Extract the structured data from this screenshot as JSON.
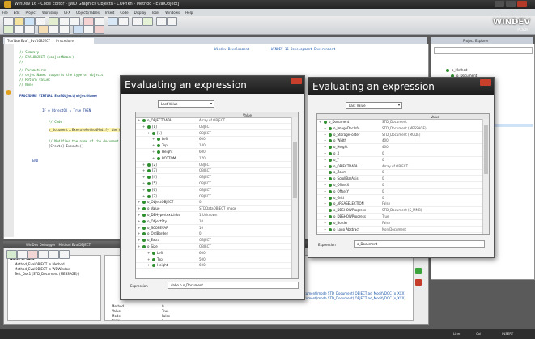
{
  "window": {
    "title": "WinDev 16 - Code Editor - [WD Graphics Objects - COPYkn - Method - EvalObject]",
    "brand": "WINDEV",
    "brand_sub": "PCSOFT"
  },
  "menu": [
    "File",
    "Edit",
    "Project",
    "Workshop",
    "GFX",
    "Objects/Tables",
    "Insert",
    "Code",
    "Display",
    "Tools",
    "Windows",
    "Help"
  ],
  "editor": {
    "tab_label": "ToolbarEval_EvalOBJECT - Procedure",
    "header_link1": "Windev Development",
    "header_link2": "WINDEV 16 Development Environment",
    "lines": [
      "// Summary",
      "//  EVALOBJECT (<objectName>)",
      "//",
      "// Parameters:",
      "//   objectName: supports the type of objects",
      "// Return value:",
      "//   None",
      "PROCEDURE VIRTUAL EvalObject(objectName)",
      "  IF o_ObjectOK = True THEN",
      "    // Code",
      "    o_Document..ExecuteMethodModify the name",
      "    // Modifies the name of the document",
      "    [Create] Execute()",
      "  END"
    ]
  },
  "right_panel": {
    "title": "Project Explorer",
    "root": "o_Method",
    "child": "o_Document"
  },
  "bottom_panel": {
    "title": "WinDev Debugger - Method EvalOBJECT",
    "col1": "Name of calls",
    "call1": "Method_EvalOBJECT in Method",
    "call2": "Method_EvalOBJECT in WDWindow",
    "call3": "Test_Doc1 (STD_Document (MESSAGE))",
    "long_path1": "Document(mode STD_Document) OBJECT ad_ModifyDOC (o_XXX)",
    "long_path2": "Document(mode STD_Document) OBJECT ad_ModifyDOC (o_XXX)",
    "rows": [
      {
        "n": "Method",
        "v": "0"
      },
      {
        "n": "Value",
        "v": "True"
      },
      {
        "n": "Mode",
        "v": "False"
      },
      {
        "n": "Binary",
        "v": "0"
      }
    ]
  },
  "status": {
    "left": "",
    "right1": "Line",
    "right2": "Col",
    "right3": "INSERT"
  },
  "dialog_left": {
    "title": "Evaluating an expression",
    "combo": "Last Value",
    "col_name": "",
    "col_value": "Value",
    "rows": [
      {
        "name": "o_OBJECTDATA",
        "value": "Array of OBJECT"
      },
      {
        "name": "[1]",
        "value": "OBJECT"
      },
      {
        "name": "[1]",
        "value": "OBJECT"
      },
      {
        "name": "Left",
        "value": "600"
      },
      {
        "name": "Top",
        "value": "140"
      },
      {
        "name": "Height",
        "value": "600"
      },
      {
        "name": "BOTTOM",
        "value": "170"
      },
      {
        "name": "[2]",
        "value": "OBJECT"
      },
      {
        "name": "[3]",
        "value": "OBJECT"
      },
      {
        "name": "[4]",
        "value": "OBJECT"
      },
      {
        "name": "[5]",
        "value": "OBJECT"
      },
      {
        "name": "[6]",
        "value": "OBJECT"
      },
      {
        "name": "[7]",
        "value": "OBJECT"
      },
      {
        "name": "o_ObjectOBJECT",
        "value": "0"
      },
      {
        "name": "o_Value",
        "value": "STDDataOBJECT Image"
      },
      {
        "name": "o_DBHypertextLinks",
        "value": "1 Unknown"
      },
      {
        "name": "o_ObjectSty",
        "value": "10"
      },
      {
        "name": "o_SCOPEVAR",
        "value": "10"
      },
      {
        "name": "o_OrdBorder",
        "value": "0"
      },
      {
        "name": "o_Extra",
        "value": "OBJECT"
      },
      {
        "name": "o_Size",
        "value": "OBJECT"
      },
      {
        "name": "Left",
        "value": "600"
      },
      {
        "name": "Top",
        "value": "500"
      },
      {
        "name": "Height",
        "value": "600"
      }
    ],
    "expr_label": "Expression",
    "expr_value": "daho.o.o_Document"
  },
  "dialog_right": {
    "title": "Evaluating an expression",
    "combo": "Last Value",
    "col_name": "",
    "col_value": "Value",
    "rows": [
      {
        "name": "o_Document",
        "value": "STD_Document"
      },
      {
        "name": "o_ImageDocInfo",
        "value": "STD_Document (MESSAGE)"
      },
      {
        "name": "o_StorageFolder",
        "value": "STD_Document (MODE)"
      },
      {
        "name": "o_Width",
        "value": "400"
      },
      {
        "name": "o_Height",
        "value": "400"
      },
      {
        "name": "o_X",
        "value": "0"
      },
      {
        "name": "o_Y",
        "value": "0"
      },
      {
        "name": "o_OBJECTDATA",
        "value": "Array of OBJECT"
      },
      {
        "name": "o_Zoom",
        "value": "0"
      },
      {
        "name": "o_ScrollBarAxis",
        "value": "0"
      },
      {
        "name": "o_OffsetX",
        "value": "0"
      },
      {
        "name": "o_OffsetY",
        "value": "0"
      },
      {
        "name": "o_Grid",
        "value": "0"
      },
      {
        "name": "o_AREASELECTION",
        "value": "False"
      },
      {
        "name": "o_DBSHOWProgress",
        "value": "STD_Document (S_MMB)"
      },
      {
        "name": "o_DBSHOWProgress",
        "value": "True"
      },
      {
        "name": "o_Border",
        "value": "False"
      },
      {
        "name": "o_Logo Abstract",
        "value": "Non Document"
      }
    ],
    "expr_label": "Expression",
    "expr_value": "o_Document"
  }
}
